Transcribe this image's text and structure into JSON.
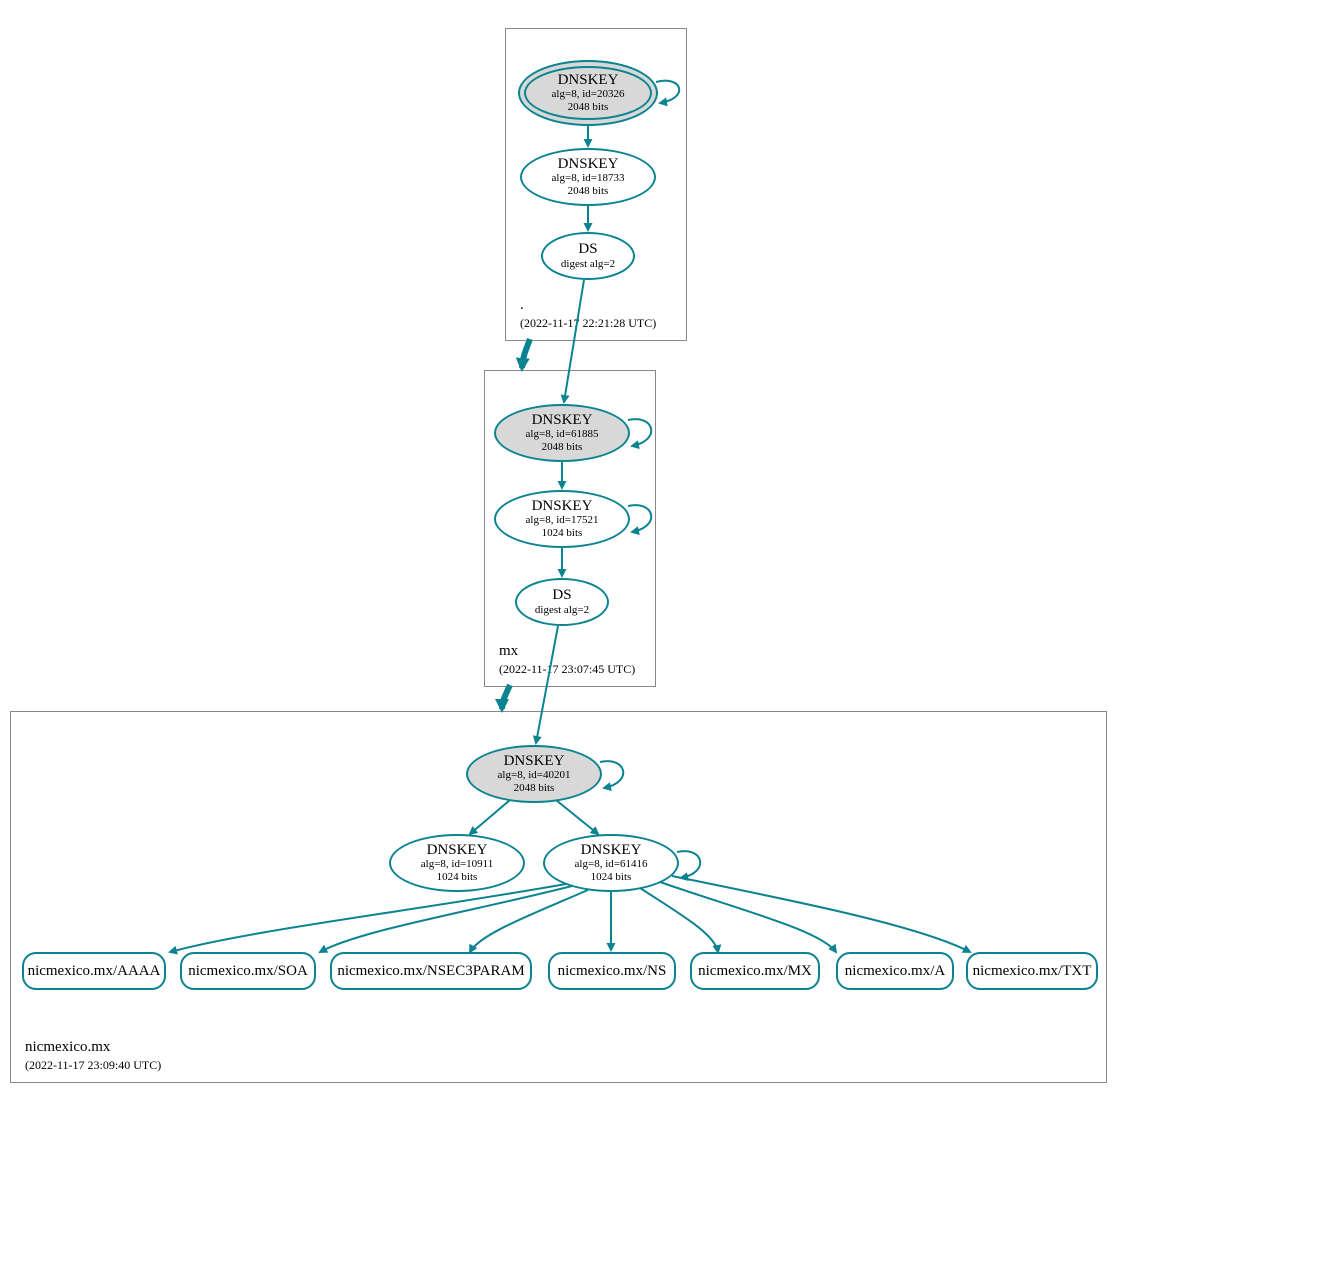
{
  "zones": {
    "root": {
      "name": ".",
      "timestamp": "(2022-11-17 22:21:28 UTC)"
    },
    "mx": {
      "name": "mx",
      "timestamp": "(2022-11-17 23:07:45 UTC)"
    },
    "nicmexico": {
      "name": "nicmexico.mx",
      "timestamp": "(2022-11-17 23:09:40 UTC)"
    }
  },
  "nodes": {
    "root_ksk": {
      "title": "DNSKEY",
      "l1": "alg=8, id=20326",
      "l2": "2048 bits"
    },
    "root_zsk": {
      "title": "DNSKEY",
      "l1": "alg=8, id=18733",
      "l2": "2048 bits"
    },
    "root_ds": {
      "title": "DS",
      "l1": "digest alg=2",
      "l2": ""
    },
    "mx_ksk": {
      "title": "DNSKEY",
      "l1": "alg=8, id=61885",
      "l2": "2048 bits"
    },
    "mx_zsk": {
      "title": "DNSKEY",
      "l1": "alg=8, id=17521",
      "l2": "1024 bits"
    },
    "mx_ds": {
      "title": "DS",
      "l1": "digest alg=2",
      "l2": ""
    },
    "nic_ksk": {
      "title": "DNSKEY",
      "l1": "alg=8, id=40201",
      "l2": "2048 bits"
    },
    "nic_z1": {
      "title": "DNSKEY",
      "l1": "alg=8, id=10911",
      "l2": "1024 bits"
    },
    "nic_z2": {
      "title": "DNSKEY",
      "l1": "alg=8, id=61416",
      "l2": "1024 bits"
    }
  },
  "rrsets": {
    "aaaa": "nicmexico.mx/AAAA",
    "soa": "nicmexico.mx/SOA",
    "nsec3param": "nicmexico.mx/NSEC3PARAM",
    "ns": "nicmexico.mx/NS",
    "mx": "nicmexico.mx/MX",
    "a": "nicmexico.mx/A",
    "txt": "nicmexico.mx/TXT"
  }
}
